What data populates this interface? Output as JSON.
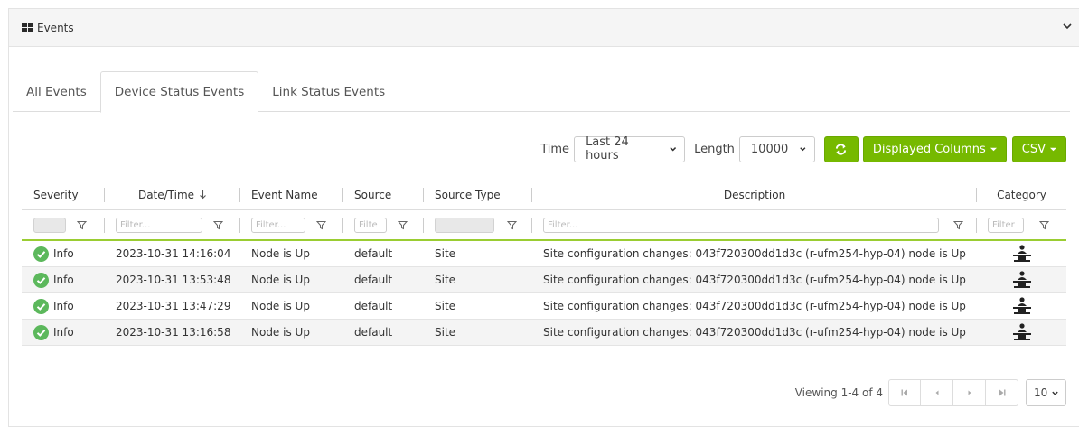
{
  "panel": {
    "title": "Events",
    "icon": "grid-icon",
    "collapse_icon": "chevron-down-icon"
  },
  "tabs": [
    {
      "label": "All Events",
      "active": false
    },
    {
      "label": "Device Status Events",
      "active": true
    },
    {
      "label": "Link Status Events",
      "active": false
    }
  ],
  "toolbar": {
    "time_label": "Time",
    "time_value": "Last 24 hours",
    "length_label": "Length",
    "length_value": "10000",
    "refresh_icon": "refresh-icon",
    "displayed_columns_label": "Displayed Columns",
    "csv_label": "CSV"
  },
  "table": {
    "headers": {
      "severity": "Severity",
      "datetime": "Date/Time",
      "event_name": "Event Name",
      "source": "Source",
      "source_type": "Source Type",
      "description": "Description",
      "category": "Category"
    },
    "filter_placeholders": {
      "datetime": "Filter...",
      "event_name": "Filter...",
      "source": "Filte",
      "description": "Filter...",
      "category": "Filter"
    },
    "rows": [
      {
        "severity": "Info",
        "datetime": "2023-10-31 14:16:04",
        "event_name": "Node is Up",
        "source": "default",
        "source_type": "Site",
        "description": "Site configuration changes: 043f720300dd1d3c (r-ufm254-hyp-04) node is Up",
        "category_icon": "network-node-icon"
      },
      {
        "severity": "Info",
        "datetime": "2023-10-31 13:53:48",
        "event_name": "Node is Up",
        "source": "default",
        "source_type": "Site",
        "description": "Site configuration changes: 043f720300dd1d3c (r-ufm254-hyp-04) node is Up",
        "category_icon": "network-node-icon"
      },
      {
        "severity": "Info",
        "datetime": "2023-10-31 13:47:29",
        "event_name": "Node is Up",
        "source": "default",
        "source_type": "Site",
        "description": "Site configuration changes: 043f720300dd1d3c (r-ufm254-hyp-04) node is Up",
        "category_icon": "network-node-icon"
      },
      {
        "severity": "Info",
        "datetime": "2023-10-31 13:16:58",
        "event_name": "Node is Up",
        "source": "default",
        "source_type": "Site",
        "description": "Site configuration changes: 043f720300dd1d3c (r-ufm254-hyp-04) node is Up",
        "category_icon": "network-node-icon"
      }
    ]
  },
  "pager": {
    "viewing": "Viewing 1-4 of 4",
    "page_size": "10"
  },
  "colors": {
    "accent_green": "#76b900",
    "info_green": "#5cb85c"
  }
}
